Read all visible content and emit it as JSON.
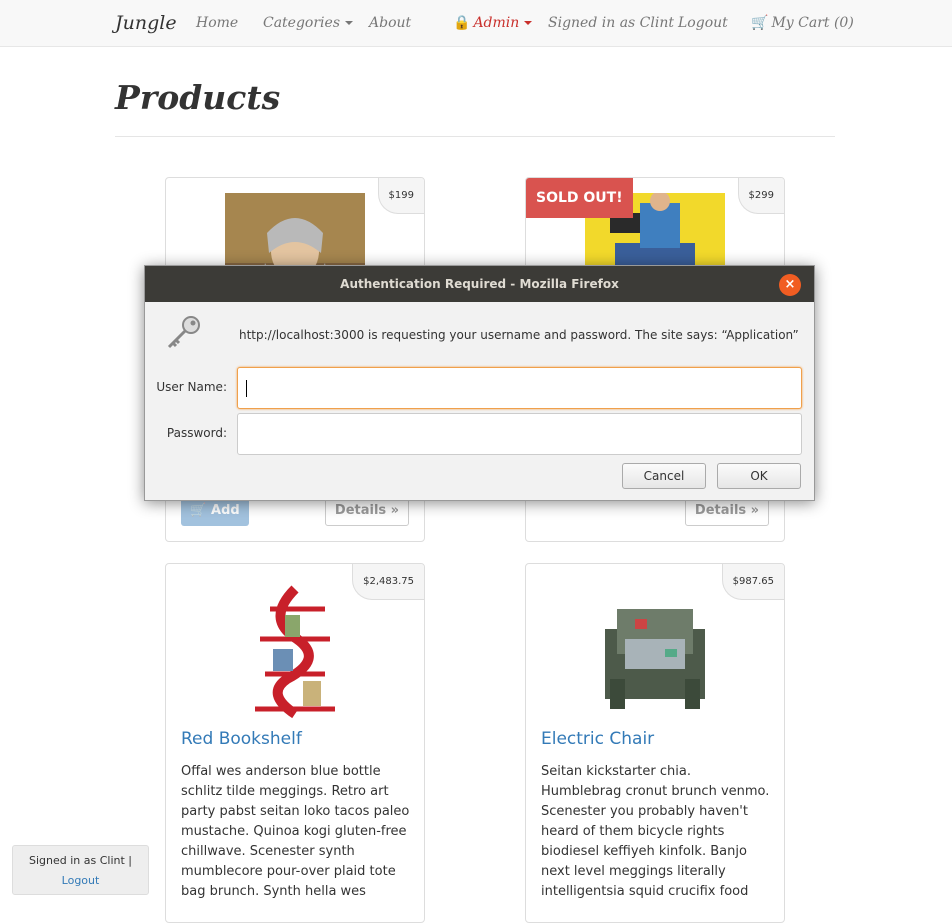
{
  "navbar": {
    "brand": "Jungle",
    "home": "Home",
    "categories": "Categories",
    "about": "About",
    "admin": "Admin",
    "signed_in": "Signed in as Clint",
    "logout": "Logout",
    "cart": "My Cart (0)"
  },
  "page": {
    "title": "Products"
  },
  "products": [
    {
      "price": "$199",
      "title": "",
      "desc": "",
      "add_label": "Add",
      "details_label": "Details »",
      "image_icon": "wizard-photo"
    },
    {
      "price": "$299",
      "sold_out": "SOLD OUT!",
      "details_label": "Details »",
      "image_icon": "jeans-photo"
    },
    {
      "price": "$2,483.75",
      "title": "Red Bookshelf",
      "desc": "Offal wes anderson blue bottle schlitz tilde meggings. Retro art party pabst seitan loko tacos paleo mustache. Quinoa kogi gluten-free chillwave. Scenester synth mumblecore pour-over plaid tote bag brunch. Synth hella wes",
      "image_icon": "red-bookshelf-photo"
    },
    {
      "price": "$987.65",
      "title": "Electric Chair",
      "desc": "Seitan kickstarter chia. Humblebrag cronut brunch venmo. Scenester you probably haven't heard of them bicycle rights biodiesel keffiyeh kinfolk. Banjo next level meggings literally intelligentsia squid crucifix food",
      "image_icon": "electric-chair-photo"
    }
  ],
  "signin_badge": {
    "text": "Signed in as Clint |",
    "logout": "Logout"
  },
  "dialog": {
    "title": "Authentication Required - Mozilla Firefox",
    "message": "http://localhost:3000 is requesting your username and password. The site says: “Application”",
    "username_label": "User Name:",
    "password_label": "Password:",
    "username_value": "",
    "password_value": "",
    "cancel": "Cancel",
    "ok": "OK"
  },
  "colors": {
    "accent": "#337ab7",
    "danger": "#d9534f",
    "admin": "#c9302c",
    "titlebar": "#3c3b37",
    "close": "#f15d22"
  }
}
